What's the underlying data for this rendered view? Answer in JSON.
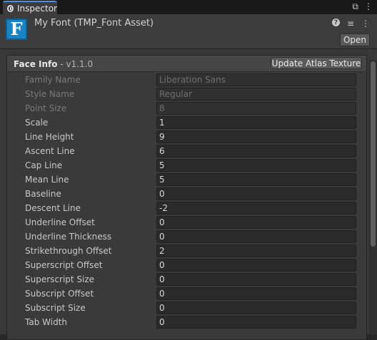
{
  "tab": {
    "label": "Inspector",
    "tools": [
      "⧉",
      "⋮"
    ]
  },
  "header": {
    "icon_letter": "F",
    "title": "My Font (TMP_Font Asset)",
    "help_glyph": "?",
    "settings_glyph": "≡",
    "menu_glyph": "⋮",
    "open_label": "Open"
  },
  "section": {
    "title": "Face Info",
    "version": " - v1.1.0",
    "update_label": "Update Atlas Texture"
  },
  "rows": [
    {
      "label": "Family Name",
      "value": "Liberation Sans",
      "disabled": true
    },
    {
      "label": "Style Name",
      "value": "Regular",
      "disabled": true
    },
    {
      "label": "Point Size",
      "value": "8",
      "disabled": true
    },
    {
      "label": "Scale",
      "value": "1",
      "disabled": false
    },
    {
      "label": "Line Height",
      "value": "9",
      "disabled": false
    },
    {
      "label": "Ascent Line",
      "value": "6",
      "disabled": false
    },
    {
      "label": "Cap Line",
      "value": "5",
      "disabled": false
    },
    {
      "label": "Mean Line",
      "value": "5",
      "disabled": false
    },
    {
      "label": "Baseline",
      "value": "0",
      "disabled": false
    },
    {
      "label": "Descent Line",
      "value": "-2",
      "disabled": false
    },
    {
      "label": "Underline Offset",
      "value": "0",
      "disabled": false
    },
    {
      "label": "Underline Thickness",
      "value": "0",
      "disabled": false
    },
    {
      "label": "Strikethrough Offset",
      "value": "2",
      "disabled": false
    },
    {
      "label": "Superscript Offset",
      "value": "0",
      "disabled": false
    },
    {
      "label": "Superscript Size",
      "value": "0",
      "disabled": false
    },
    {
      "label": "Subscript Offset",
      "value": "0",
      "disabled": false
    },
    {
      "label": "Subscript Size",
      "value": "0",
      "disabled": false
    },
    {
      "label": "Tab Width",
      "value": "0",
      "disabled": false
    }
  ]
}
